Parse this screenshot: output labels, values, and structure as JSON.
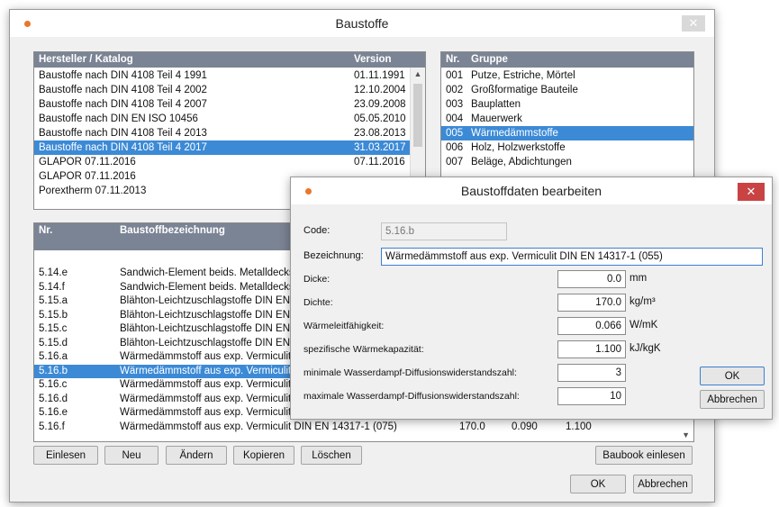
{
  "main_window": {
    "title": "Baustoffe",
    "close_symbol": "✕",
    "catalog": {
      "col_name": "Hersteller / Katalog",
      "col_version": "Version",
      "rows": [
        {
          "name": "Baustoffe nach DIN 4108 Teil 4 1991",
          "version": "01.11.1991"
        },
        {
          "name": "Baustoffe nach DIN 4108 Teil 4 2002",
          "version": "12.10.2004"
        },
        {
          "name": "Baustoffe nach DIN 4108 Teil 4 2007",
          "version": "23.09.2008"
        },
        {
          "name": "Baustoffe nach DIN EN ISO 10456",
          "version": "05.05.2010"
        },
        {
          "name": "Baustoffe nach DIN 4108 Teil 4 2013",
          "version": "23.08.2013"
        },
        {
          "name": "Baustoffe nach DIN 4108 Teil 4 2017",
          "version": "31.03.2017"
        },
        {
          "name": "GLAPOR 07.11.2016",
          "version": "07.11.2016"
        },
        {
          "name": "GLAPOR 07.11.2016",
          "version": ""
        },
        {
          "name": "Porextherm 07.11.2013",
          "version": ""
        }
      ],
      "selected_index": 5
    },
    "groups": {
      "col_nr": "Nr.",
      "col_group": "Gruppe",
      "rows": [
        {
          "nr": "001",
          "name": "Putze, Estriche, Mörtel"
        },
        {
          "nr": "002",
          "name": "Großformatige Bauteile"
        },
        {
          "nr": "003",
          "name": "Bauplatten"
        },
        {
          "nr": "004",
          "name": "Mauerwerk"
        },
        {
          "nr": "005",
          "name": "Wärmedämmstoffe"
        },
        {
          "nr": "006",
          "name": "Holz, Holzwerkstoffe"
        },
        {
          "nr": "007",
          "name": "Beläge, Abdichtungen"
        }
      ],
      "selected_index": 4
    },
    "materials": {
      "col_nr": "Nr.",
      "col_name": "Baustoffbezeichnung",
      "rows": [
        {
          "nr": "5.14.e",
          "name": "Sandwich-Element beids. Metalldecks"
        },
        {
          "nr": "5.14.f",
          "name": "Sandwich-Element beids. Metalldecks"
        },
        {
          "nr": "5.15.a",
          "name": "Blähton-Leichtzuschlagstoffe DIN EN"
        },
        {
          "nr": "5.15.b",
          "name": "Blähton-Leichtzuschlagstoffe DIN EN"
        },
        {
          "nr": "5.15.c",
          "name": "Blähton-Leichtzuschlagstoffe DIN EN"
        },
        {
          "nr": "5.15.d",
          "name": "Blähton-Leichtzuschlagstoffe DIN EN"
        },
        {
          "nr": "5.16.a",
          "name": "Wärmedämmstoff aus exp. Vermiculit D"
        },
        {
          "nr": "5.16.b",
          "name": "Wärmedämmstoff aus exp. Vermiculit D"
        },
        {
          "nr": "5.16.c",
          "name": "Wärmedämmstoff aus exp. Vermiculit D"
        },
        {
          "nr": "5.16.d",
          "name": "Wärmedämmstoff aus exp. Vermiculit D"
        },
        {
          "nr": "5.16.e",
          "name": "Wärmedämmstoff aus exp. Vermiculit D"
        },
        {
          "nr": "5.16.f",
          "name": "Wärmedämmstoff aus exp. Vermiculit DIN EN 14317-1 (075)",
          "density": "170.0",
          "lambda": "0.090",
          "capacity": "1.100"
        }
      ],
      "selected_index": 7
    },
    "buttons": {
      "einlesen": "Einlesen",
      "neu": "Neu",
      "aendern": "Ändern",
      "kopieren": "Kopieren",
      "loeschen": "Löschen",
      "baubook": "Baubook einlesen",
      "ok": "OK",
      "abbrechen": "Abbrechen"
    },
    "scroll_up": "▲",
    "scroll_down": "▼"
  },
  "dialog": {
    "title": "Baustoffdaten bearbeiten",
    "close_symbol": "✕",
    "code_label": "Code:",
    "code_value": "5.16.b",
    "name_label": "Bezeichnung:",
    "name_value": "Wärmedämmstoff aus exp. Vermiculit DIN EN 14317-1 (055)",
    "fields": [
      {
        "label": "Dicke:",
        "value": "0.0",
        "unit": "mm"
      },
      {
        "label": "Dichte:",
        "value": "170.0",
        "unit": "kg/m³"
      },
      {
        "label": "Wärmeleitfähigkeit:",
        "value": "0.066",
        "unit": "W/mK"
      },
      {
        "label": "spezifische Wärmekapazität:",
        "value": "1.100",
        "unit": "kJ/kgK"
      },
      {
        "label": "minimale Wasserdampf-Diffusionswiderstandszahl:",
        "value": "3",
        "unit": ""
      },
      {
        "label": "maximale Wasserdampf-Diffusionswiderstandszahl:",
        "value": "10",
        "unit": ""
      }
    ],
    "ok_label": "OK",
    "cancel_label": "Abbrechen"
  }
}
